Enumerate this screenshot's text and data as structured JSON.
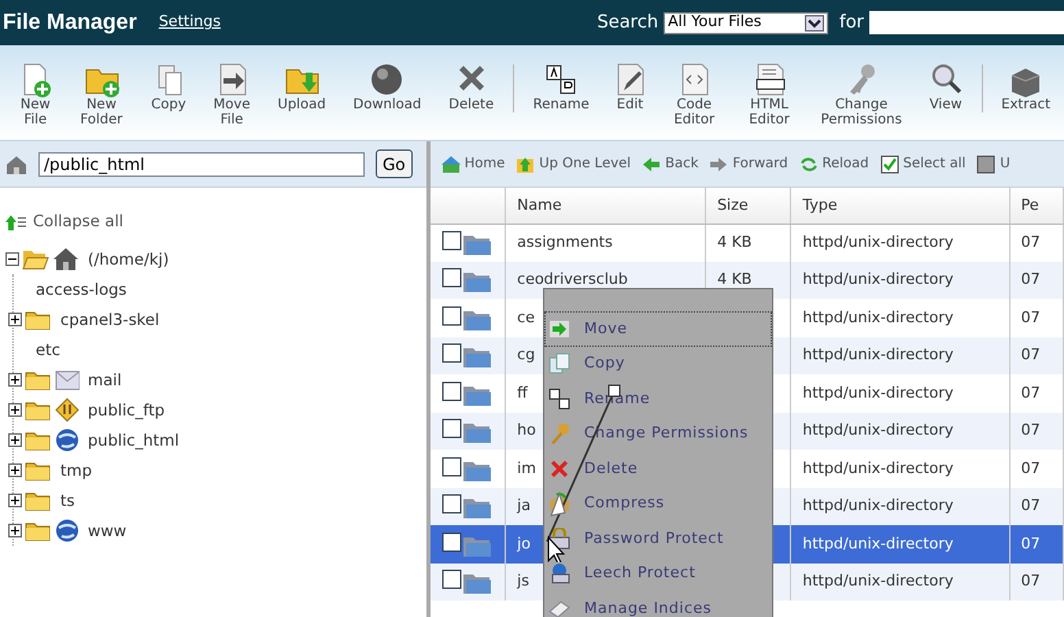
{
  "header": {
    "title": "File Manager",
    "settings_link": "Settings",
    "search_label": "Search",
    "search_scope": "All Your Files",
    "for_label": "for"
  },
  "toolbar": [
    {
      "label": "New File"
    },
    {
      "label": "New Folder"
    },
    {
      "label": "Copy"
    },
    {
      "label": "Move File"
    },
    {
      "label": "Upload"
    },
    {
      "label": "Download"
    },
    {
      "label": "Delete"
    },
    {
      "label": "Rename",
      "separator_before": true
    },
    {
      "label": "Edit"
    },
    {
      "label": "Code Editor"
    },
    {
      "label": "HTML Editor"
    },
    {
      "label": "Change Permissions"
    },
    {
      "label": "View"
    },
    {
      "label": "Extract",
      "separator_before": true
    }
  ],
  "path_bar": {
    "value": "/public_html",
    "button": "Go"
  },
  "nav_bar": [
    {
      "label": "Home"
    },
    {
      "label": "Up One Level"
    },
    {
      "label": "Back"
    },
    {
      "label": "Forward"
    },
    {
      "label": "Reload"
    },
    {
      "label": "Select all",
      "checked": true
    },
    {
      "label": "U",
      "checked": false
    }
  ],
  "tree": {
    "collapse_label": "Collapse all",
    "root": {
      "label": "(/home/kj)",
      "expanded": true,
      "children": [
        {
          "label": "access-logs",
          "kind": "leaf"
        },
        {
          "label": "cpanel3-skel",
          "kind": "folder"
        },
        {
          "label": "etc",
          "kind": "leaf"
        },
        {
          "label": "mail",
          "kind": "mail"
        },
        {
          "label": "public_ftp",
          "kind": "ftp"
        },
        {
          "label": "public_html",
          "kind": "web"
        },
        {
          "label": "tmp",
          "kind": "folder"
        },
        {
          "label": "ts",
          "kind": "folder"
        },
        {
          "label": "www",
          "kind": "web"
        }
      ]
    }
  },
  "table": {
    "columns": [
      "Name",
      "Size",
      "Type",
      "Pe"
    ],
    "rows": [
      {
        "name": "assignments",
        "size": "4 KB",
        "type": "httpd/unix-directory",
        "perm": "07",
        "selected": false
      },
      {
        "name": "ceodriversclub",
        "size": "4 KB",
        "type": "httpd/unix-directory",
        "perm": "07",
        "selected": false
      },
      {
        "name": "ce",
        "type": "httpd/unix-directory",
        "perm": "07",
        "selected": false
      },
      {
        "name": "cg",
        "type": "httpd/unix-directory",
        "perm": "07",
        "selected": false
      },
      {
        "name": "ff",
        "type": "httpd/unix-directory",
        "perm": "07",
        "selected": false
      },
      {
        "name": "ho",
        "type": "httpd/unix-directory",
        "perm": "07",
        "selected": false
      },
      {
        "name": "im",
        "type": "httpd/unix-directory",
        "perm": "07",
        "selected": false
      },
      {
        "name": "ja",
        "type": "httpd/unix-directory",
        "perm": "07",
        "selected": false
      },
      {
        "name": "jo",
        "type": "httpd/unix-directory",
        "perm": "07",
        "selected": true
      },
      {
        "name": "js",
        "type": "httpd/unix-directory",
        "perm": "07",
        "selected": false
      }
    ]
  },
  "context_menu": [
    {
      "label": "Move",
      "focused": true
    },
    {
      "label": "Copy",
      "focused": false
    },
    {
      "label": "Rename",
      "focused": false
    },
    {
      "label": "Change Permissions",
      "focused": false
    },
    {
      "label": "Delete",
      "focused": false
    },
    {
      "label": "Compress",
      "focused": false
    },
    {
      "label": "Password Protect",
      "focused": false
    },
    {
      "label": "Leech Protect",
      "focused": false
    },
    {
      "label": "Manage Indices",
      "focused": false
    }
  ]
}
